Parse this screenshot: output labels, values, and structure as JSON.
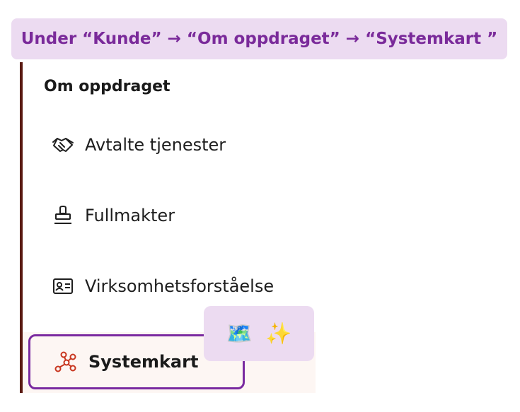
{
  "banner": {
    "text": "Under “Kunde” → “Om oppdraget” → “Systemkart ”"
  },
  "sidebar": {
    "section_title": "Om oppdraget",
    "items": [
      {
        "label": "Avtalte tjenester",
        "icon": "handshake-icon"
      },
      {
        "label": "Fullmakter",
        "icon": "stamp-icon"
      },
      {
        "label": "Virksomhetsforståelse",
        "icon": "id-card-icon"
      },
      {
        "label": "Systemkart",
        "icon": "network-graph-icon",
        "active": true
      }
    ]
  },
  "badge": {
    "emojis": [
      "🗺️",
      "✨"
    ]
  },
  "colors": {
    "banner_bg": "#ecdbf1",
    "banner_text": "#7a2a9a",
    "rail": "#5a1a12",
    "active_border": "#7a2aa0",
    "active_icon": "#c8361f"
  }
}
